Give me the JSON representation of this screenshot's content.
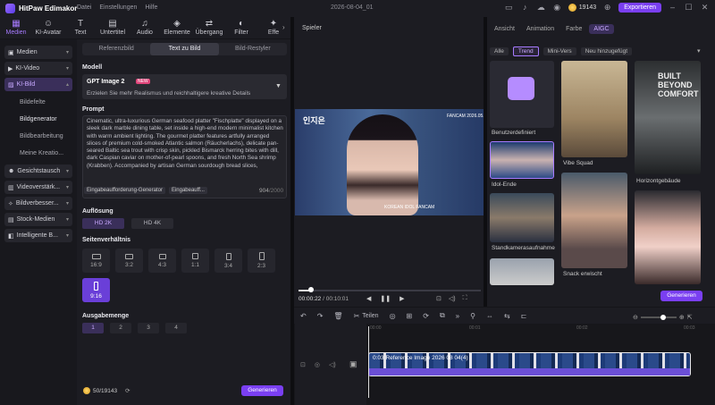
{
  "titlebar": {
    "app_name": "HitPaw Edimakor",
    "menus": [
      "Datei",
      "Einstellungen",
      "Hilfe"
    ],
    "doc_title": "2026-08-04_01",
    "credits": "19143",
    "export_label": "Exportieren"
  },
  "toolbar": {
    "items": [
      {
        "label": "Medien",
        "glyph": "▦"
      },
      {
        "label": "KI-Avatar",
        "glyph": "☺"
      },
      {
        "label": "Text",
        "glyph": "T"
      },
      {
        "label": "Untertitel",
        "glyph": "▤"
      },
      {
        "label": "Audio",
        "glyph": "♫"
      },
      {
        "label": "Elemente",
        "glyph": "◈"
      },
      {
        "label": "Übergang",
        "glyph": "⇄"
      },
      {
        "label": "Filter",
        "glyph": "◐"
      },
      {
        "label": "Effe",
        "glyph": "✦"
      }
    ]
  },
  "nav": {
    "items": [
      {
        "label": "Medien"
      },
      {
        "label": "KI-Video"
      },
      {
        "label": "KI-Bild"
      }
    ],
    "sub_items": [
      "Bildefelte",
      "Bildgenerator",
      "Bildbearbeitung",
      "Meine Kreatio..."
    ],
    "items2": [
      {
        "label": "Gesichtstausch"
      },
      {
        "label": "Videoverstärk..."
      },
      {
        "label": "Bildverbesser..."
      },
      {
        "label": "Stock-Medien"
      },
      {
        "label": "Intelligente B..."
      }
    ]
  },
  "panel": {
    "seg": [
      "Referenzbild",
      "Text zu Bild",
      "Bild-Restyler"
    ],
    "model_label": "Modell",
    "model_name": "GPT Image 2",
    "model_badge": "NEW",
    "model_desc": "Erzielen Sie mehr Realismus und reichhaltigere kreative Details",
    "prompt_label": "Prompt",
    "prompt_text": "Cinematic, ultra-luxurious German seafood platter \"Fischplatte\" displayed on a sleek dark marble dining table, set inside a high-end modern minimalist kitchen with warm ambient lighting. The gourmet platter features artfully arranged slices of premium cold-smoked Atlantic salmon (Räucherlachs), delicate pan-seared Baltic sea trout with crisp skin, pickled Bismarck herring bites with dill, dark Caspian caviar on mother-of-pearl spoons, and fresh North Sea shrimp (Krabben). Accompanied by artisan German sourdough bread slices,",
    "prompt_chip1": "Eingabeaufforderung-Generator",
    "prompt_chip2": "Eingabeauff...",
    "char_count": "904",
    "char_max": "/2000",
    "res_label": "Auflösung",
    "res": [
      "HD 2K",
      "HD 4K"
    ],
    "ratio_label": "Seitenverhältnis",
    "ratios": [
      "16:9",
      "3:2",
      "4:3",
      "1:1",
      "3:4",
      "2:3",
      "9:16"
    ],
    "out_label": "Ausgabemenge",
    "outs": [
      "1",
      "2",
      "3",
      "4"
    ],
    "balance": "50/19143",
    "generate": "Generieren"
  },
  "player": {
    "label": "Spieler",
    "time_cur": "00:00:22",
    "time_total": "/ 00:10:01",
    "vid_logo": "인지은",
    "vid_tag": "FANCAM  2026.05.26",
    "vid_sub": "KOREAN IDOL FANCAM",
    "progress_fraction": 0.07
  },
  "right": {
    "tabs": [
      "Ansicht",
      "Animation",
      "Farbe",
      "AIGC"
    ],
    "filters": [
      "Alle",
      "Trend",
      "Mini-Vers",
      "Neu hinzugefügt"
    ],
    "thumbs": [
      "Benutzerdefiniert",
      "Vibe Squad",
      "Horizontgebäude",
      "Idol-Ende",
      "Standkamerasaufnahme",
      "Snack erwischt"
    ],
    "poster_text": "BUILT BEYOND COMFORT",
    "generate": "Generieren"
  },
  "timeline": {
    "tools": [
      "↶",
      "↷",
      "🗑",
      "✂",
      "◎",
      "⊞",
      "⟳",
      "⧉",
      "»",
      "⚲",
      "⇔",
      "⇆",
      "⊏",
      "⊖"
    ],
    "cut_label": "Teilen",
    "ticks": [
      "00:00",
      "00:01",
      "00:02",
      "00:03"
    ],
    "clip_label": "0:03  Reference Image 2026 08 04(4)"
  },
  "colors": {
    "accent": "#7a3ff2",
    "active_tab": "#a77bff"
  }
}
